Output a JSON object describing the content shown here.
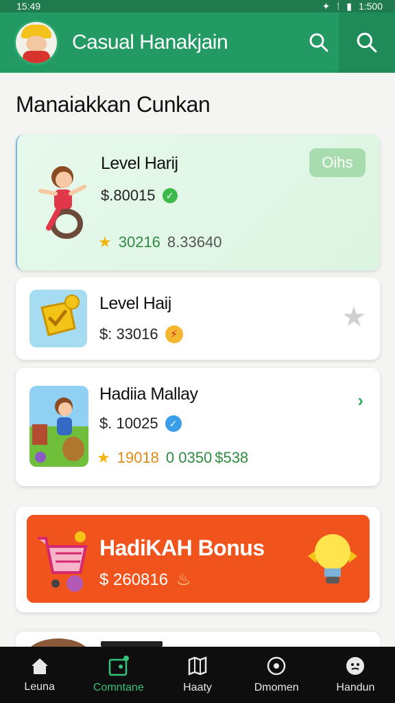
{
  "status_bar": {
    "time": "15:49",
    "battery": "1:500"
  },
  "app": {
    "title": "Casual Hanakjain"
  },
  "section_title": "Manaiakkan Cunkan",
  "cards": [
    {
      "title": "Level Harij",
      "price": "$.80015",
      "tag": "Oihs",
      "rating": "30216",
      "stat": "8.33640"
    },
    {
      "title": "Level Haij",
      "price": "$: 33016"
    },
    {
      "title": "Hadiia Mallay",
      "price": "$. 10025",
      "rating": "19018",
      "stat_a": "0 0350",
      "stat_b": "$538"
    }
  ],
  "bonus": {
    "title": "HadiKAH Bonus",
    "price": "$ 260816"
  },
  "nav": [
    {
      "label": "Leuna",
      "icon": "home-icon",
      "active": false
    },
    {
      "label": "Comntane",
      "icon": "wallet-icon",
      "active": true
    },
    {
      "label": "Haaty",
      "icon": "map-icon",
      "active": false
    },
    {
      "label": "Dmomen",
      "icon": "target-icon",
      "active": false
    },
    {
      "label": "Handun",
      "icon": "face-icon",
      "active": false
    }
  ],
  "colors": {
    "primary": "#239a63",
    "accent": "#36c47c",
    "bonus": "#f0541c",
    "nav_bg": "#0e0e0e"
  }
}
